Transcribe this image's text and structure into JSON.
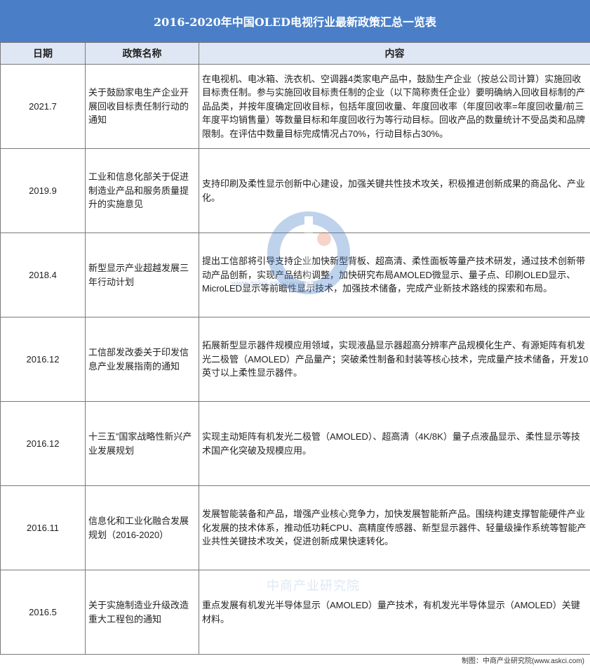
{
  "title": "2016-2020年中国OLED电视行业最新政策汇总一览表",
  "headers": {
    "date": "日期",
    "name": "政策名称",
    "content": "内容"
  },
  "rows": [
    {
      "date": "2021.7",
      "name": "关于鼓励家电生产企业开展回收目标责任制行动的通知",
      "content": "在电视机、电冰箱、洗衣机、空调器4类家电产品中，鼓励生产企业（按总公司计算）实施回收目标责任制。参与实施回收目标责任制的企业（以下简称责任企业）要明确纳入回收目标制的产品品类，并按年度确定回收目标，包括年度回收量、年度回收率（年度回收率=年度回收量/前三年度平均销售量）等数量目标和年度回收行为等行动目标。回收产品的数量统计不受品类和品牌限制。在评估中数量目标完成情况占70%，行动目标占30%。"
    },
    {
      "date": "2019.9",
      "name": "工业和信息化部关于促进制造业产品和服务质量提升的实施意见",
      "content": "支持印刷及柔性显示创新中心建设，加强关键共性技术攻关，积极推进创新成果的商品化、产业化。"
    },
    {
      "date": "2018.4",
      "name": "新型显示产业超越发展三年行动计划",
      "content": "提出工信部将引导支持企业加快新型背板、超高清、柔性面板等量产技术研发，通过技术创新带动产品创新，实现产品结构调整，加快研究布局AMOLED微显示、量子点、印刷OLED显示、MicroLED显示等前瞻性显示技术，加强技术储备，完成产业新技术路线的探索和布局。"
    },
    {
      "date": "2016.12",
      "name": "工信部发改委关于印发信息产业发展指南的通知",
      "content": "拓展新型显示器件规模应用领域，实现液晶显示器超高分辨率产品规模化生产、有源矩阵有机发光二极管（AMOLED）产品量产；突破柔性制备和封装等核心技术，完成量产技术储备，开发10英寸以上柔性显示器件。"
    },
    {
      "date": "2016.12",
      "name": "十三五”国家战略性新兴产业发展规划",
      "content": "实现主动矩阵有机发光二极管（AMOLED）、超高清（4K/8K）量子点液晶显示、柔性显示等技术国产化突破及规模应用。"
    },
    {
      "date": "2016.11",
      "name": "信息化和工业化融合发展规划（2016-2020）",
      "content": "发展智能装备和产品，增强产业核心竞争力，加快发展智能新产品。围绕构建支撑智能硬件产业化发展的技术体系，推动低功耗CPU、高精度传感器、新型显示器件、轻量级操作系统等智能产业共性关键技术攻关，促进创新成果快速转化。"
    },
    {
      "date": "2016.5",
      "name": "关于实施制造业升级改造重大工程包的通知",
      "content": "重点发展有机发光半导体显示（AMOLED）量产技术，有机发光半导体显示（AMOLED）关键材料。"
    }
  ],
  "footer": "制图：中商产业研究院(www.askci.com)",
  "watermark": {
    "url": "www.askci.com/reports/",
    "name": "中商产业研究院"
  },
  "colors": {
    "title_bg": "#4a7fc7",
    "header_bg": "#dfe7f4",
    "border": "#7a7a7a"
  }
}
